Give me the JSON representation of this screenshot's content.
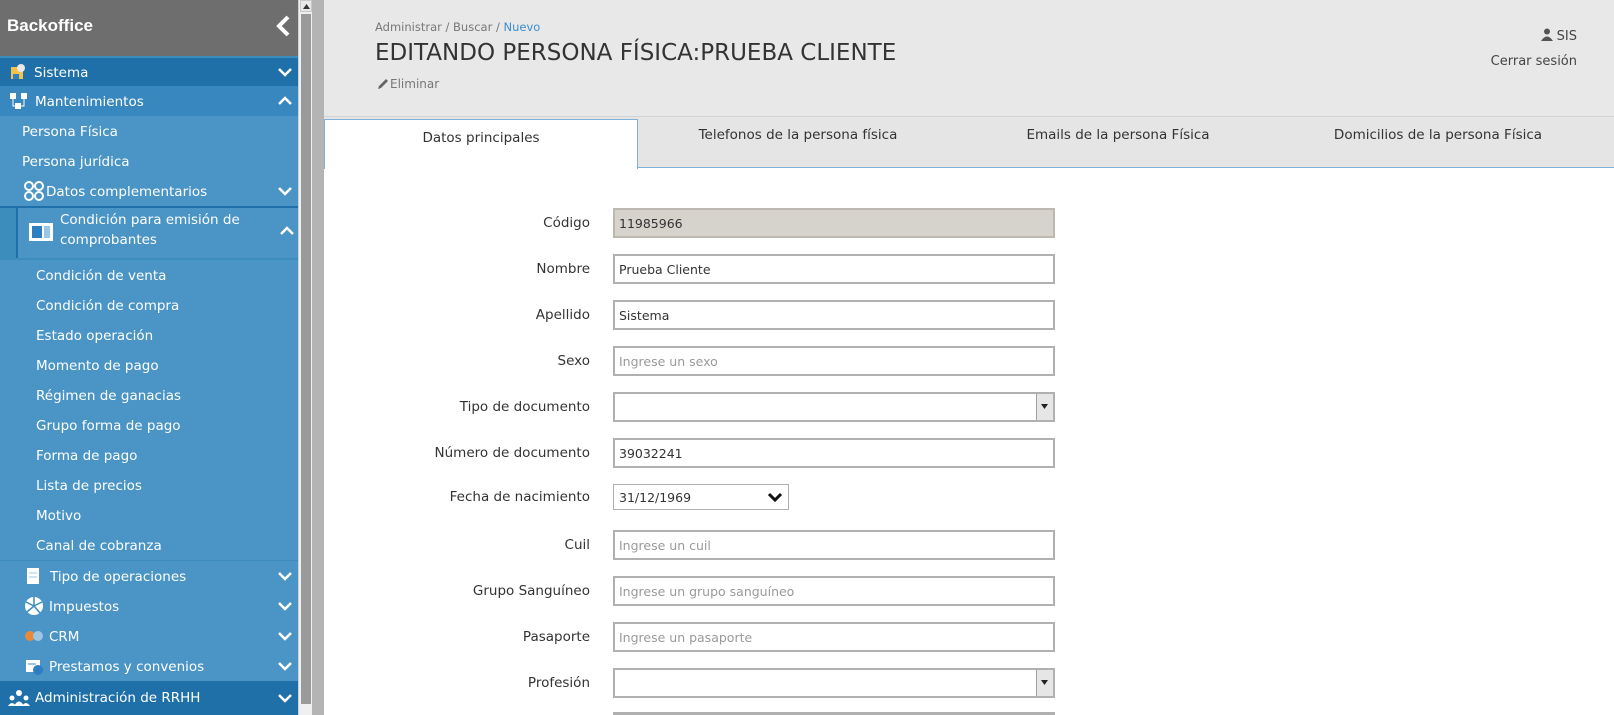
{
  "sidebar": {
    "brand": "Backoffice",
    "items": {
      "sistema": "Sistema",
      "mantenimientos": "Mantenimientos",
      "persona_fisica": "Persona Física",
      "persona_juridica": "Persona jurídica",
      "datos_complementarios": "Datos complementarios",
      "condicion_emision_1": "Condición para emisión de",
      "condicion_emision_2": "comprobantes",
      "condicion_venta": "Condición de venta",
      "condicion_compra": "Condición de compra",
      "estado_operacion": "Estado operación",
      "momento_pago": "Momento de pago",
      "regimen_ganancias": "Régimen de ganacias",
      "grupo_forma_pago": "Grupo forma de pago",
      "forma_pago": "Forma de pago",
      "lista_precios": "Lista de precios",
      "motivo": "Motivo",
      "canal_cobranza": "Canal de cobranza",
      "tipo_operaciones": "Tipo de operaciones",
      "impuestos": "Impuestos",
      "crm": "CRM",
      "prestamos": "Prestamos y convenios",
      "rrhh": "Administración de RRHH"
    }
  },
  "header": {
    "breadcrumb": {
      "b1": "Administrar",
      "sep": " / ",
      "b2": "Buscar",
      "b3": "Nuevo"
    },
    "title": "EDITANDO PERSONA FÍSICA:PRUEBA CLIENTE",
    "delete_label": "Eliminar",
    "user": "SIS",
    "logout": "Cerrar sesión"
  },
  "tabs": {
    "datos": "Datos principales",
    "telefonos": "Telefonos de la persona física",
    "emails": "Emails de la persona Física",
    "domicilios": "Domicilios de la persona Física"
  },
  "form": {
    "codigo": {
      "label": "Código",
      "value": "11985966"
    },
    "nombre": {
      "label": "Nombre",
      "value": "Prueba Cliente"
    },
    "apellido": {
      "label": "Apellido",
      "value": "Sistema"
    },
    "sexo": {
      "label": "Sexo",
      "placeholder": "Ingrese un sexo"
    },
    "tipo_documento": {
      "label": "Tipo de documento",
      "value": ""
    },
    "numero_documento": {
      "label": "Número de documento",
      "value": "39032241"
    },
    "fecha_nacimiento": {
      "label": "Fecha de nacimiento",
      "value": "31/12/1969"
    },
    "cuil": {
      "label": "Cuil",
      "placeholder": "Ingrese un cuil"
    },
    "grupo_sanguineo": {
      "label": "Grupo Sanguíneo",
      "placeholder": "Ingrese un grupo sanguíneo"
    },
    "pasaporte": {
      "label": "Pasaporte",
      "placeholder": "Ingrese un pasaporte"
    },
    "profesion": {
      "label": "Profesión",
      "value": ""
    }
  },
  "colors": {
    "sidebar_dark": "#1f6fa8",
    "sidebar": "#3c8dbc",
    "accent": "#3a8fd0",
    "header_bg": "#e8e8e8"
  }
}
